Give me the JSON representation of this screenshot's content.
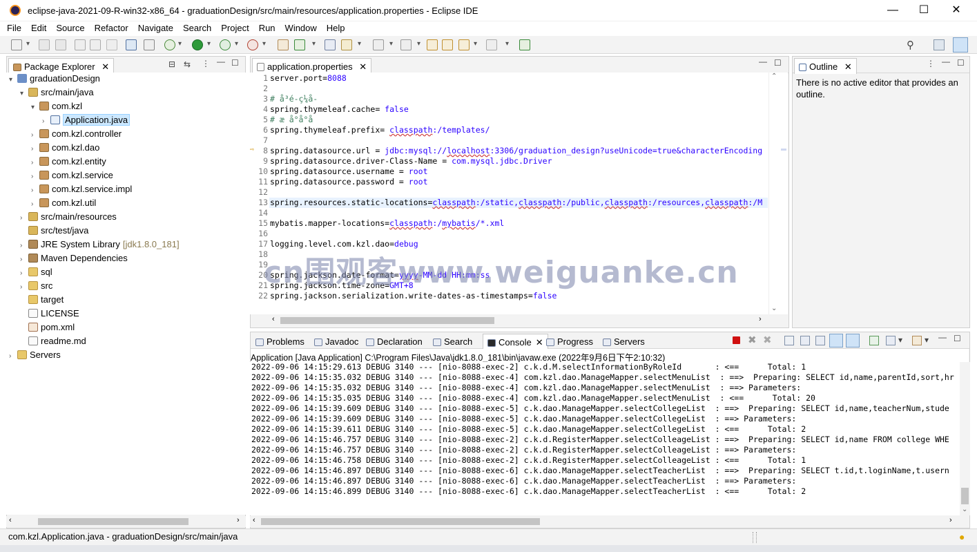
{
  "window": {
    "title": "eclipse-java-2021-09-R-win32-x86_64 - graduationDesign/src/main/resources/application.properties - Eclipse IDE",
    "minimize": "—",
    "maximize": "☐",
    "close": "✕"
  },
  "menu": [
    "File",
    "Edit",
    "Source",
    "Refactor",
    "Navigate",
    "Search",
    "Project",
    "Run",
    "Window",
    "Help"
  ],
  "package_explorer": {
    "tab_label": "Package Explorer",
    "items": [
      {
        "label": "graduationDesign",
        "icon": "project-icon",
        "arrow": "▾",
        "indent": 0
      },
      {
        "label": "src/main/java",
        "icon": "source-folder-icon",
        "arrow": "▾",
        "indent": 1
      },
      {
        "label": "com.kzl",
        "icon": "package-icon",
        "arrow": "▾",
        "indent": 2
      },
      {
        "label": "Application.java",
        "icon": "java-file-icon",
        "arrow": "›",
        "indent": 3,
        "selected": true
      },
      {
        "label": "com.kzl.controller",
        "icon": "package-icon",
        "arrow": "›",
        "indent": 2
      },
      {
        "label": "com.kzl.dao",
        "icon": "package-icon",
        "arrow": "›",
        "indent": 2
      },
      {
        "label": "com.kzl.entity",
        "icon": "package-icon",
        "arrow": "›",
        "indent": 2
      },
      {
        "label": "com.kzl.service",
        "icon": "package-icon",
        "arrow": "›",
        "indent": 2
      },
      {
        "label": "com.kzl.service.impl",
        "icon": "package-icon",
        "arrow": "›",
        "indent": 2
      },
      {
        "label": "com.kzl.util",
        "icon": "package-icon",
        "arrow": "›",
        "indent": 2
      },
      {
        "label": "src/main/resources",
        "icon": "source-folder-icon",
        "arrow": "›",
        "indent": 1
      },
      {
        "label": "src/test/java",
        "icon": "source-folder-icon",
        "arrow": "",
        "indent": 1
      },
      {
        "label": "JRE System Library",
        "suffix": "[jdk1.8.0_181]",
        "icon": "library-icon",
        "arrow": "›",
        "indent": 1
      },
      {
        "label": "Maven Dependencies",
        "icon": "library-icon",
        "arrow": "›",
        "indent": 1
      },
      {
        "label": "sql",
        "icon": "folder-icon",
        "arrow": "›",
        "indent": 1
      },
      {
        "label": "src",
        "icon": "folder-icon",
        "arrow": "›",
        "indent": 1
      },
      {
        "label": "target",
        "icon": "folder-icon",
        "arrow": "",
        "indent": 1
      },
      {
        "label": "LICENSE",
        "icon": "file-icon",
        "arrow": "",
        "indent": 1
      },
      {
        "label": "pom.xml",
        "icon": "xml-file-icon",
        "arrow": "",
        "indent": 1
      },
      {
        "label": "readme.md",
        "icon": "file-icon",
        "arrow": "",
        "indent": 1
      },
      {
        "label": "Servers",
        "icon": "folder-icon",
        "arrow": "›",
        "indent": 0
      }
    ]
  },
  "editor": {
    "tab_label": "application.properties",
    "lines": [
      {
        "n": "1",
        "segs": [
          [
            "k",
            "server.port="
          ],
          [
            "v",
            "8088"
          ]
        ]
      },
      {
        "n": "2",
        "segs": []
      },
      {
        "n": "3",
        "segs": [
          [
            "c",
            "# å³é-ç¼å-"
          ]
        ]
      },
      {
        "n": "4",
        "segs": [
          [
            "k",
            "spring.thymeleaf.cache= "
          ],
          [
            "v",
            "false"
          ]
        ]
      },
      {
        "n": "5",
        "segs": [
          [
            "c",
            "# æ å°å°å"
          ]
        ]
      },
      {
        "n": "6",
        "segs": [
          [
            "k",
            "spring.thymeleaf.prefix= "
          ],
          [
            "vu",
            "classpath"
          ],
          [
            "v",
            ":/templates/"
          ]
        ]
      },
      {
        "n": "7",
        "segs": []
      },
      {
        "n": "8",
        "segs": [
          [
            "k",
            "spring.datasource.url = "
          ],
          [
            "v",
            "jdbc:mysql://"
          ],
          [
            "vu",
            "localhost"
          ],
          [
            "v",
            ":3306/graduation_design?useUnicode=true&characterEncoding"
          ]
        ]
      },
      {
        "n": "9",
        "segs": [
          [
            "k",
            "spring.datasource.driver-Class-Name = "
          ],
          [
            "v",
            "com.mysql.jdbc.Driver"
          ]
        ]
      },
      {
        "n": "10",
        "segs": [
          [
            "k",
            "spring.datasource.username = "
          ],
          [
            "v",
            "root"
          ]
        ]
      },
      {
        "n": "11",
        "segs": [
          [
            "k",
            "spring.datasource.password = "
          ],
          [
            "v",
            "root"
          ]
        ]
      },
      {
        "n": "12",
        "segs": []
      },
      {
        "n": "13",
        "segs": [
          [
            "k",
            "spring.resources.static-locations="
          ],
          [
            "vu",
            "classpath"
          ],
          [
            "v",
            ":/static,"
          ],
          [
            "vu",
            "classpath"
          ],
          [
            "v",
            ":/public,"
          ],
          [
            "vu",
            "classpath"
          ],
          [
            "v",
            ":/resources,"
          ],
          [
            "vu",
            "classpath"
          ],
          [
            "v",
            ":/M"
          ]
        ]
      },
      {
        "n": "14",
        "segs": []
      },
      {
        "n": "15",
        "segs": [
          [
            "k",
            "mybatis.mapper-locations="
          ],
          [
            "vu",
            "classpath"
          ],
          [
            "v",
            ":/"
          ],
          [
            "vu",
            "mybatis"
          ],
          [
            "v",
            "/*.xml"
          ]
        ]
      },
      {
        "n": "16",
        "segs": []
      },
      {
        "n": "17",
        "segs": [
          [
            "k",
            "logging.level.com.kzl.dao="
          ],
          [
            "v",
            "debug"
          ]
        ]
      },
      {
        "n": "18",
        "segs": []
      },
      {
        "n": "19",
        "segs": []
      },
      {
        "n": "20",
        "segs": [
          [
            "k",
            "spring.jackson.date-format="
          ],
          [
            "vu",
            "yyyy"
          ],
          [
            "v",
            "-MM-dd HH:mm:ss"
          ]
        ]
      },
      {
        "n": "21",
        "segs": [
          [
            "k",
            "spring.jackson.time-zone="
          ],
          [
            "v",
            "GMT+8"
          ]
        ]
      },
      {
        "n": "22",
        "segs": [
          [
            "k",
            "spring.jackson.serialization.write-dates-as-timestamps="
          ],
          [
            "v",
            "false"
          ]
        ]
      }
    ]
  },
  "outline": {
    "tab_label": "Outline",
    "message": "There is no active editor that provides an outline."
  },
  "bottom_tabs": [
    "Problems",
    "Javadoc",
    "Declaration",
    "Search",
    "Console",
    "Progress",
    "Servers"
  ],
  "console": {
    "header": "Application [Java Application] C:\\Program Files\\Java\\jdk1.8.0_181\\bin\\javaw.exe  (2022年9月6日下午2:10:32)",
    "lines": [
      "2022-09-06 14:15:29.613 DEBUG 3140 --- [nio-8088-exec-2] c.k.d.M.selectInformationByRoleId       : <==      Total: 1",
      "2022-09-06 14:15:35.032 DEBUG 3140 --- [nio-8088-exec-4] com.kzl.dao.ManageMapper.selectMenuList  : ==>  Preparing: SELECT id,name,parentId,sort,hr",
      "2022-09-06 14:15:35.032 DEBUG 3140 --- [nio-8088-exec-4] com.kzl.dao.ManageMapper.selectMenuList  : ==> Parameters: ",
      "2022-09-06 14:15:35.035 DEBUG 3140 --- [nio-8088-exec-4] com.kzl.dao.ManageMapper.selectMenuList  : <==      Total: 20",
      "2022-09-06 14:15:39.609 DEBUG 3140 --- [nio-8088-exec-5] c.k.dao.ManageMapper.selectCollegeList  : ==>  Preparing: SELECT id,name,teacherNum,stude",
      "2022-09-06 14:15:39.609 DEBUG 3140 --- [nio-8088-exec-5] c.k.dao.ManageMapper.selectCollegeList  : ==> Parameters: ",
      "2022-09-06 14:15:39.611 DEBUG 3140 --- [nio-8088-exec-5] c.k.dao.ManageMapper.selectCollegeList  : <==      Total: 2",
      "2022-09-06 14:15:46.757 DEBUG 3140 --- [nio-8088-exec-2] c.k.d.RegisterMapper.selectColleageList : ==>  Preparing: SELECT id,name FROM college WHE",
      "2022-09-06 14:15:46.757 DEBUG 3140 --- [nio-8088-exec-2] c.k.d.RegisterMapper.selectColleageList : ==> Parameters: ",
      "2022-09-06 14:15:46.758 DEBUG 3140 --- [nio-8088-exec-2] c.k.d.RegisterMapper.selectColleageList : <==      Total: 1",
      "2022-09-06 14:15:46.897 DEBUG 3140 --- [nio-8088-exec-6] c.k.dao.ManageMapper.selectTeacherList  : ==>  Preparing: SELECT t.id,t.loginName,t.usern",
      "2022-09-06 14:15:46.897 DEBUG 3140 --- [nio-8088-exec-6] c.k.dao.ManageMapper.selectTeacherList  : ==> Parameters: ",
      "2022-09-06 14:15:46.899 DEBUG 3140 --- [nio-8088-exec-6] c.k.dao.ManageMapper.selectTeacherList  : <==      Total: 2"
    ]
  },
  "status_bar": {
    "text": "com.kzl.Application.java - graduationDesign/src/main/java"
  },
  "watermark": "cn围观客www.weiguanke.cn",
  "colors": {
    "value": "#2a00ff",
    "comment": "#3f7f5f",
    "selection": "#cce8ff",
    "stop_red": "#d01010"
  }
}
